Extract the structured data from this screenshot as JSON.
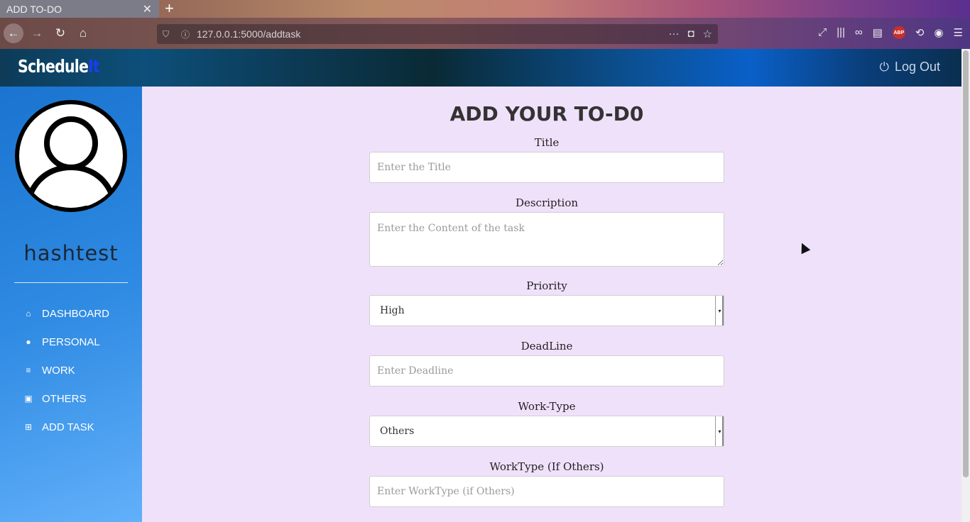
{
  "browser": {
    "tab_title": "ADD TO-DO",
    "url": "127.0.0.1:5000/addtask"
  },
  "app": {
    "logo_part1": "Schedule",
    "logo_part2": "It",
    "logout_label": "Log Out"
  },
  "sidebar": {
    "username": "hashtest",
    "items": [
      {
        "label": "DASHBOARD",
        "icon": "home-icon"
      },
      {
        "label": "PERSONAL",
        "icon": "user-icon"
      },
      {
        "label": "WORK",
        "icon": "list-icon"
      },
      {
        "label": "OTHERS",
        "icon": "box-icon"
      },
      {
        "label": "ADD TASK",
        "icon": "plus-square-icon"
      }
    ]
  },
  "form": {
    "heading": "ADD YOUR TO-D0",
    "title_label": "Title",
    "title_placeholder": "Enter the Title",
    "description_label": "Description",
    "description_placeholder": "Enter the Content of the task",
    "priority_label": "Priority",
    "priority_value": "High",
    "deadline_label": "DeadLine",
    "deadline_placeholder": "Enter Deadline",
    "worktype_label": "Work-Type",
    "worktype_value": "Others",
    "worktype_other_label": "WorkType (If Others)",
    "worktype_other_placeholder": "Enter WorkType (if Others)"
  }
}
